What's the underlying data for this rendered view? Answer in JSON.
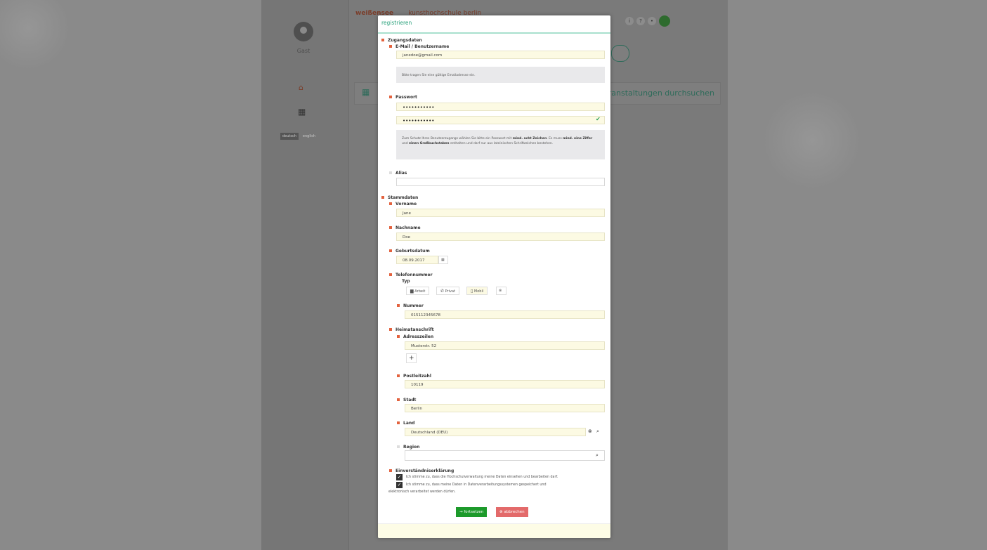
{
  "app": {
    "title": "weißensee",
    "subtitle": "kunsthochschule berlin",
    "sidebar": {
      "guest_label": "Gast",
      "lang_de": "deutsch",
      "lang_en": "english"
    },
    "banner_text": "veranstaltungen durchsuchen"
  },
  "modal": {
    "title": "registrieren",
    "access": {
      "section": "Zugangsdaten",
      "email_label": "E-Mail / Benutzername",
      "email_value": "janedoe@gmail.com",
      "email_hint": "Bitte tragen Sie eine gültige Emailadresse ein.",
      "password_label": "Passwort",
      "password_value": "•••••••••••",
      "password_confirm_value": "•••••••••••",
      "password_hint_1": "Zum Schutz Ihres Benutzerzugangs wählen Sie bitte ein Passwort mit ",
      "password_hint_b1": "mind. acht Zeichen",
      "password_hint_2": ". Es muss ",
      "password_hint_b2": "mind. eine Ziffer",
      "password_hint_3": " und ",
      "password_hint_b3": "einen Großbuchstaben",
      "password_hint_4": " enthalten und darf nur aus lateinischen Schriftzeichen bestehen.",
      "alias_label": "Alias",
      "alias_value": ""
    },
    "master": {
      "section": "Stammdaten",
      "firstname_label": "Vorname",
      "firstname_value": "Jane",
      "lastname_label": "Nachname",
      "lastname_value": "Doe",
      "birth_label": "Geburtsdatum",
      "birth_value": "08.09.2017",
      "phone_label": "Telefonnummer",
      "phone_type_label": "Typ",
      "phone_types": [
        "Arbeit",
        "Privat",
        "Mobil"
      ],
      "phone_number_label": "Nummer",
      "phone_number_value": "015112345678",
      "home_label": "Heimatanschrift",
      "address_lines_label": "Adresszeilen",
      "address_value": "Musterstr. 52",
      "add_symbol": "+",
      "zip_label": "Postleitzahl",
      "zip_value": "10119",
      "city_label": "Stadt",
      "city_value": "Berlin",
      "country_label": "Land",
      "country_value": "Deutschland (DEU)",
      "region_label": "Region",
      "region_value": ""
    },
    "consent": {
      "label": "Einverständniserklärung",
      "item_1": "Ich stimme zu, dass die Hochschulverwaltung meine Daten einsehen und bearbeiten darf.",
      "item_2a": "Ich stimme zu, dass meine Daten in Datenverarbeitungssystemen gespeichert und",
      "item_2b": "elektronisch verarbeitet werden dürfen."
    },
    "buttons": {
      "continue": "fortsetzen",
      "cancel": "abbrechen"
    }
  },
  "colors": {
    "accent": "#27a07a",
    "required": "#e3623e",
    "continue": "#1c9a2a",
    "cancel": "#e36a6a"
  }
}
